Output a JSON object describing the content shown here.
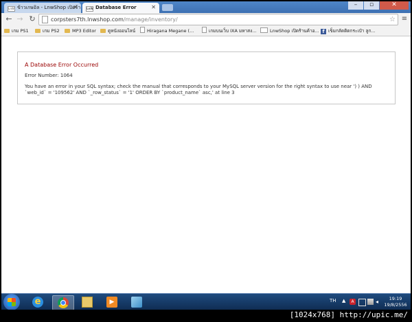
{
  "browser": {
    "tabs": [
      {
        "label": "ข้าวเกษอิล - LnwShop เปิดร้า",
        "active": false
      },
      {
        "label": "Database Error",
        "active": true
      }
    ],
    "favicon_text": "LnW",
    "url_domain": "corpsters7th.lnwshop.com",
    "url_path": "/manage/inventory/",
    "bookmarks": [
      {
        "label": "เกม PS1",
        "icon": "folder-icon"
      },
      {
        "label": "เกม PS2",
        "icon": "folder-icon"
      },
      {
        "label": "MP3 Editor",
        "icon": "folder-icon"
      },
      {
        "label": "ดูหนังออนไลน์",
        "icon": "folder-icon"
      },
      {
        "label": "Hiragana Megane (...",
        "icon": "page-icon"
      },
      {
        "label": "เกมบนเว็บ IXA มหาสง...",
        "icon": "page-icon"
      },
      {
        "label": "LnwShop เปิดร้านค้าอ...",
        "icon": "lnwshop-icon"
      },
      {
        "label": "เข็มกลัดติดกระเป๋า ลูก...",
        "icon": "facebook-icon"
      }
    ]
  },
  "page": {
    "error_heading": "A Database Error Occurred",
    "error_number": "Error Number: 1064",
    "error_message": "You have an error in your SQL syntax; check the manual that corresponds to your MySQL server version for the right syntax to use near ') ) AND `web_id` = '109562' AND `_row_status` = '1' ORDER BY `product_name` asc,' at line 3"
  },
  "taskbar": {
    "language": "TH",
    "time": "19:19",
    "date": "19/8/2556"
  },
  "watermark": "[1024x768] http://upic.me/",
  "colors": {
    "error_heading": "#990000",
    "taskbar": "#1f4b7e",
    "tab_strip": "#4f86c8"
  }
}
